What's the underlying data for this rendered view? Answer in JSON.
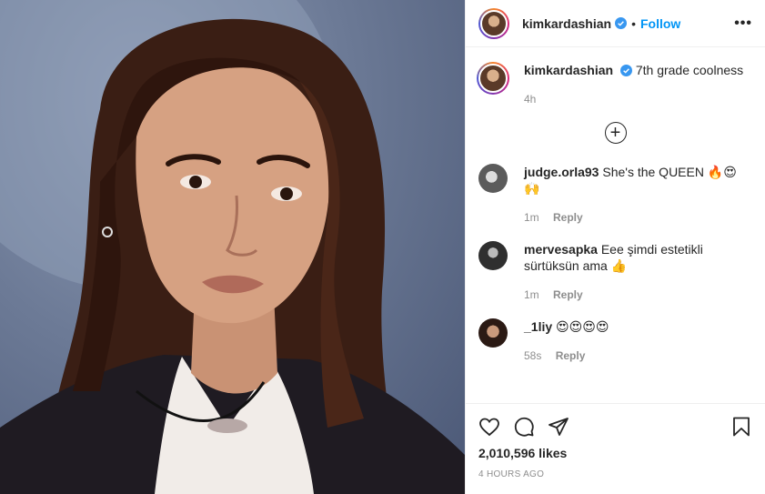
{
  "header": {
    "username": "kimkardashian",
    "dot": "•",
    "follow_label": "Follow",
    "more_label": "•••"
  },
  "caption": {
    "username": "kimkardashian",
    "text": "7th grade coolness",
    "time": "4h"
  },
  "load_more_label": "+",
  "comments": [
    {
      "username": "judge.orla93",
      "text": "She's the QUEEN 🔥😍🙌",
      "time": "1m",
      "reply_label": "Reply"
    },
    {
      "username": "mervesapka",
      "text": "Eee şimdi estetikli sürtüksün ama 👍",
      "time": "1m",
      "reply_label": "Reply"
    },
    {
      "username": "_1liy",
      "text": "😍😍😍😍",
      "time": "58s",
      "reply_label": "Reply"
    }
  ],
  "likes": "2,010,596 likes",
  "timestamp": "4 HOURS AGO",
  "colors": {
    "accent": "#0095f6",
    "verified": "#3897f0",
    "muted": "#8e8e8e"
  },
  "icons": [
    "heart-icon",
    "comment-icon",
    "share-icon",
    "save-icon",
    "verified-icon",
    "plus-circle-icon"
  ]
}
